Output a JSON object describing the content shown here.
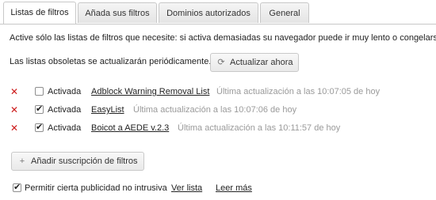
{
  "tabs": [
    {
      "label": "Listas de filtros",
      "active": true
    },
    {
      "label": "Añada sus filtros",
      "active": false
    },
    {
      "label": "Dominios autorizados",
      "active": false
    },
    {
      "label": "General",
      "active": false
    }
  ],
  "intro_text": "Active sólo las listas de filtros que necesite: si activa demasiadas su navegador puede ir muy lento o congelarse.",
  "obsolete_text": "Las listas obsoletas se actualizarán periódicamente.",
  "update_button": {
    "label": "Actualizar ahora",
    "icon": "refresh-icon"
  },
  "filter_lists": [
    {
      "enabled_label": "Activada",
      "checked": false,
      "name": "Adblock Warning Removal List",
      "last_update": "Última actualización a las 10:07:05 de hoy"
    },
    {
      "enabled_label": "Activada",
      "checked": true,
      "name": "EasyList",
      "last_update": "Última actualización a las 10:07:06 de hoy"
    },
    {
      "enabled_label": "Activada",
      "checked": true,
      "name": "Boicot a AEDE v.2.3",
      "last_update": "Última actualización a las 10:11:57 de hoy"
    }
  ],
  "add_subscription_button": {
    "label": "Añadir suscripción de filtros",
    "icon": "plus-icon"
  },
  "acceptable_ads": {
    "checked": true,
    "label": "Permitir cierta publicidad no intrusiva",
    "view_list_link": "Ver lista",
    "read_more_link": "Leer más"
  },
  "colors": {
    "remove_icon": "#cc1a1a",
    "update_text": "#9a9a9a"
  }
}
